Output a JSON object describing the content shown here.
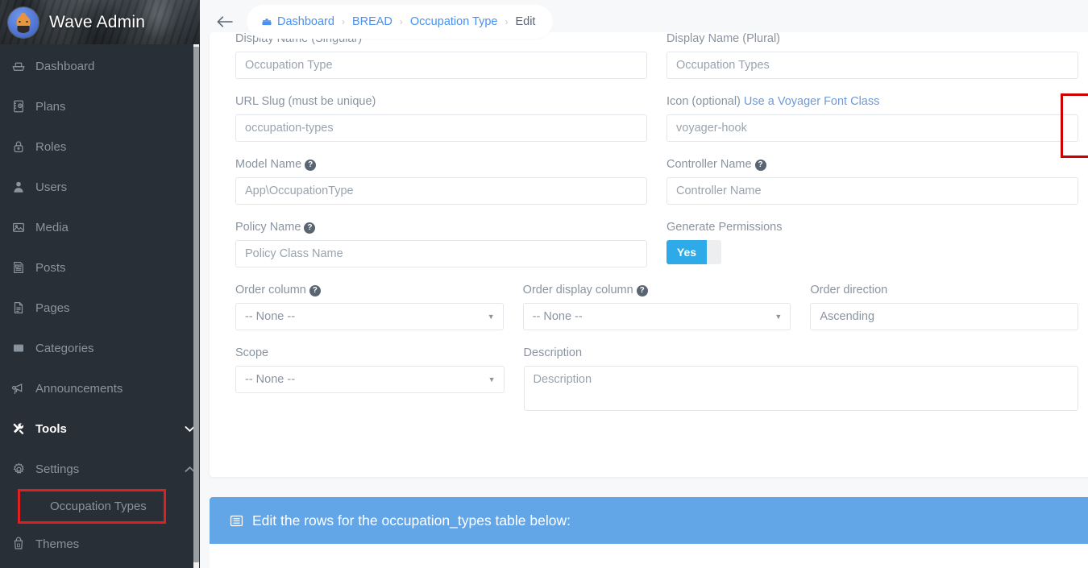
{
  "sidebar": {
    "brand": {
      "title": "Wave Admin",
      "avatar_icon": "user-avatar-icon"
    },
    "items": [
      {
        "label": "Dashboard",
        "icon": "dashboard-icon",
        "active": false
      },
      {
        "label": "Plans",
        "icon": "plans-book-icon",
        "active": false
      },
      {
        "label": "Roles",
        "icon": "lock-icon",
        "active": false
      },
      {
        "label": "Users",
        "icon": "person-icon",
        "active": false
      },
      {
        "label": "Media",
        "icon": "image-icon",
        "active": false
      },
      {
        "label": "Posts",
        "icon": "posts-icon",
        "active": false
      },
      {
        "label": "Pages",
        "icon": "pages-file-icon",
        "active": false
      },
      {
        "label": "Categories",
        "icon": "categories-box-icon",
        "active": false
      },
      {
        "label": "Announcements",
        "icon": "megaphone-icon",
        "active": false
      },
      {
        "label": "Tools",
        "icon": "tools-icon",
        "active": true,
        "caret": "chevron-down"
      },
      {
        "label": "Settings",
        "icon": "gear-icon",
        "active": false,
        "caret": "chevron-up"
      }
    ],
    "submenu_item": {
      "label": "Occupation Types",
      "highlighted": true
    },
    "last_item": {
      "label": "Themes",
      "icon": "themes-bucket-icon"
    }
  },
  "breadcrumb": {
    "back_icon": "back-arrow-icon",
    "crumbs": [
      {
        "label": "Dashboard",
        "icon": "briefcase-icon",
        "current": false
      },
      {
        "label": "BREAD",
        "icon": null,
        "current": false
      },
      {
        "label": "Occupation Type",
        "icon": null,
        "current": false
      },
      {
        "label": "Edit",
        "icon": null,
        "current": true
      }
    ],
    "separator": "›"
  },
  "form": {
    "display_name_singular": {
      "label": "Display Name (Singular)",
      "value": "Occupation Type"
    },
    "display_name_plural": {
      "label": "Display Name (Plural)",
      "value": "Occupation Types"
    },
    "url_slug": {
      "label": "URL Slug (must be unique)",
      "value": "occupation-types"
    },
    "icon_field": {
      "label_main": "Icon (optional) ",
      "label_link": "Use a Voyager Font Class",
      "value": "voyager-hook",
      "highlighted": true
    },
    "model_name": {
      "label": "Model Name",
      "help": "?",
      "value": "App\\OccupationType"
    },
    "controller_name": {
      "label": "Controller Name",
      "help": "?",
      "placeholder": "Controller Name",
      "value": ""
    },
    "policy_name": {
      "label": "Policy Name",
      "help": "?",
      "placeholder": "Policy Class Name",
      "value": ""
    },
    "generate_permissions": {
      "label": "Generate Permissions",
      "value": "Yes"
    },
    "order_column": {
      "label": "Order column",
      "help": "?",
      "value": "-- None --"
    },
    "order_display_column": {
      "label": "Order display column",
      "help": "?",
      "value": "-- None --"
    },
    "order_direction": {
      "label": "Order direction",
      "value": "Ascending"
    },
    "scope": {
      "label": "Scope",
      "value": "-- None --"
    },
    "description": {
      "label": "Description",
      "placeholder": "Description",
      "value": ""
    }
  },
  "rows_panel": {
    "title": "Edit the rows for the occupation_types table below:",
    "icon": "table-list-icon"
  },
  "colors": {
    "sidebar_bg": "#282f36",
    "sidebar_header_bg": "#3b4248",
    "accent_blue": "#4a90f0",
    "panel_blue": "#63a6e8",
    "toggle_on": "#2eaae8",
    "highlight_red": "#cc0000",
    "page_bg": "#f7f8fa",
    "label_gray": "#8a94a0"
  }
}
